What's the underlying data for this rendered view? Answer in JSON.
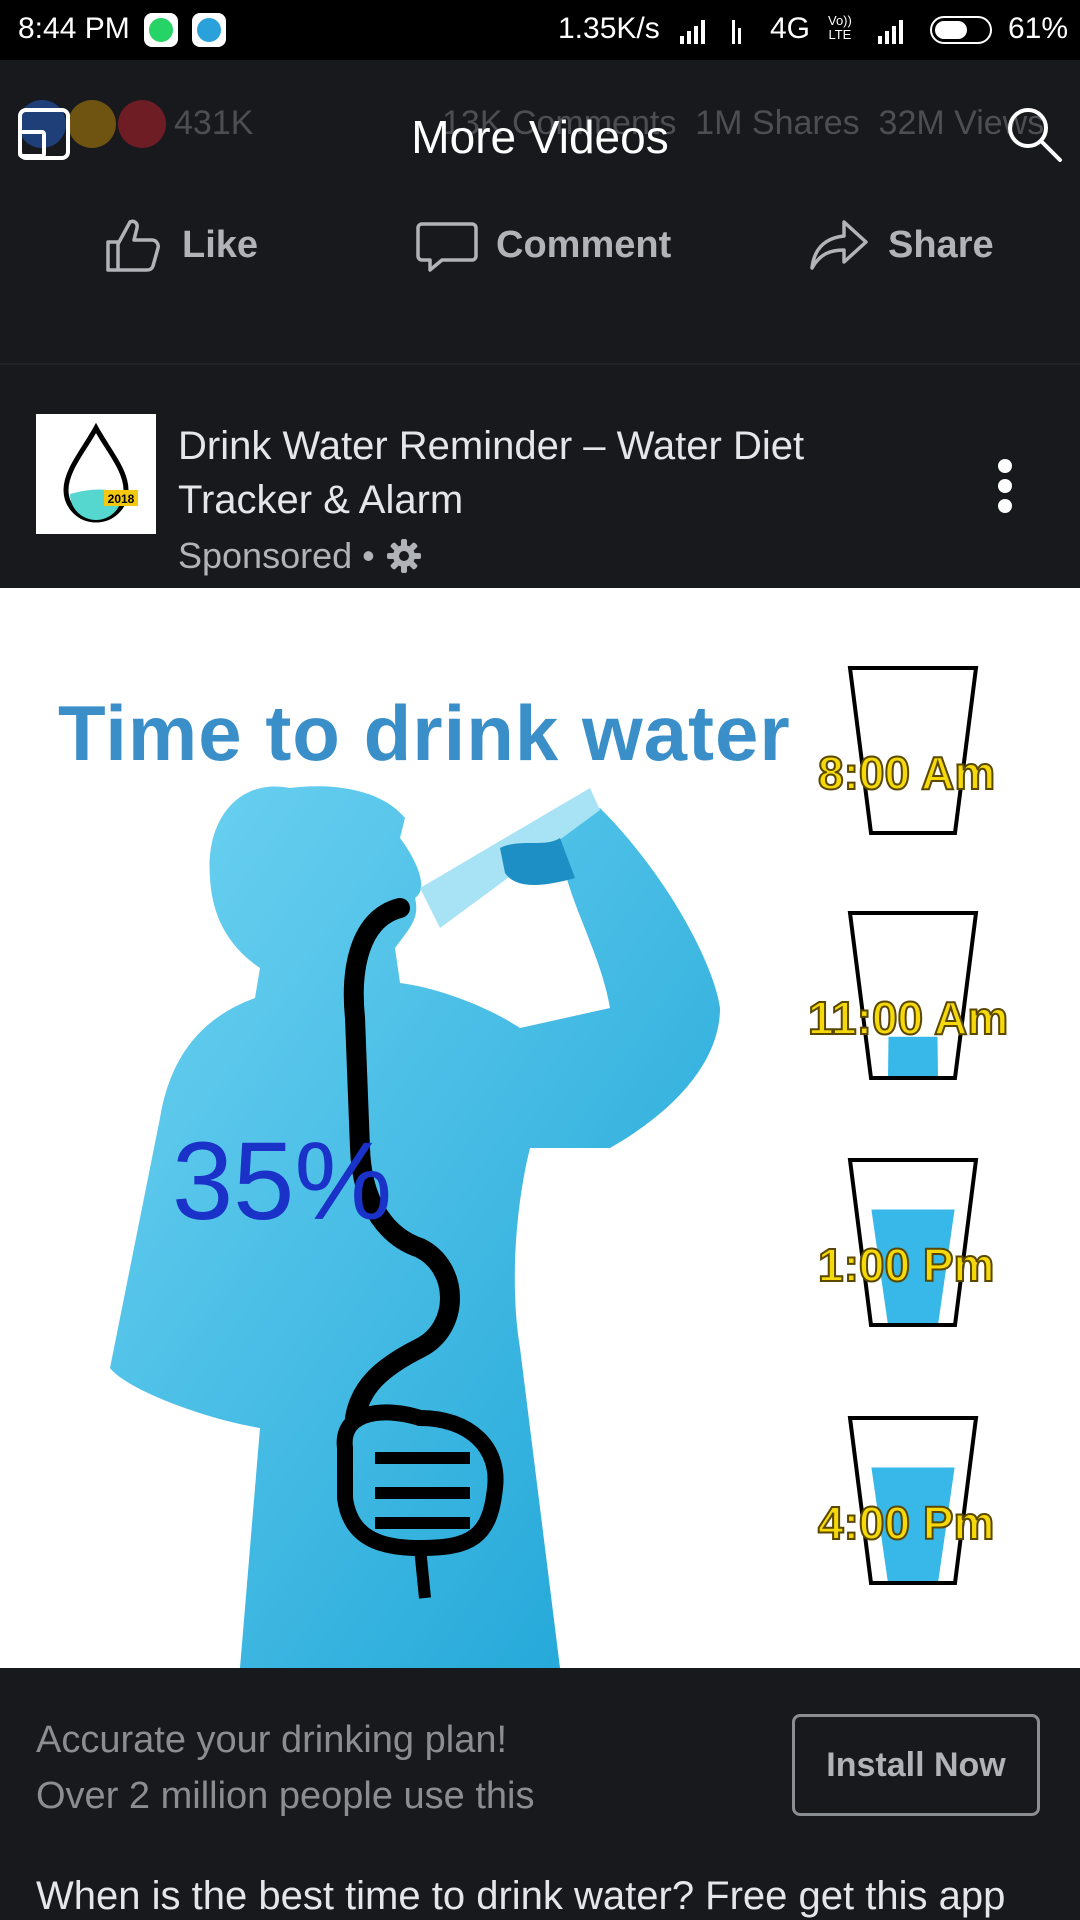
{
  "status_bar": {
    "time": "8:44 PM",
    "speed": "1.35K/s",
    "network": "4G",
    "volte_line1": "Vo))",
    "volte_line2": "LTE",
    "battery_percent": "61%",
    "battery_level": 0.61,
    "notification_icons": [
      "whatsapp-icon",
      "telegram-icon"
    ]
  },
  "header": {
    "title": "More Videos",
    "reaction_count": "431K",
    "comments": "13K Comments",
    "shares": "1M Shares",
    "views": "32M Views"
  },
  "actions": {
    "like": "Like",
    "comment": "Comment",
    "share": "Share"
  },
  "ad": {
    "title": "Drink Water Reminder – Water Diet Tracker & Alarm",
    "sponsored": "Sponsored",
    "separator": "•",
    "logo_year": "2018",
    "image": {
      "heading": "Time to drink water",
      "percent": "35%",
      "glasses": [
        {
          "time": "8:00 Am",
          "fill": 0.0
        },
        {
          "time": "11:00 Am",
          "fill": 0.25
        },
        {
          "time": "1:00 Pm",
          "fill": 0.7
        },
        {
          "time": "4:00 Pm",
          "fill": 0.7
        }
      ]
    },
    "description_line1": "Accurate your drinking plan!",
    "description_line2": "Over 2 million people use this",
    "cta": "Install Now",
    "caption": "When is the best time to drink water? Free get this app"
  },
  "colors": {
    "background": "#18191d",
    "heading_blue": "#3a8fc9",
    "percent_blue": "#1a32c8",
    "label_yellow": "#f5d90a",
    "water": "#37b8e8"
  }
}
